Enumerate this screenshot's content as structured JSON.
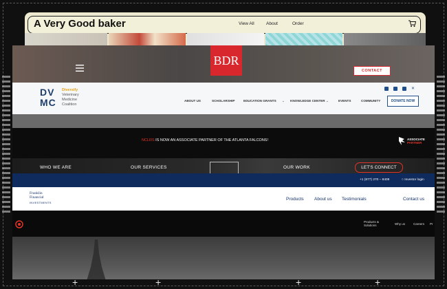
{
  "bakery": {
    "title": "A Very Good baker",
    "nav": [
      "View All",
      "About",
      "Order"
    ],
    "cart_icon": "cart-icon",
    "colors": {
      "background": "#ece9d0",
      "text": "#111111"
    }
  },
  "bdr": {
    "logo": "BDR",
    "contact": "CONTACT",
    "menu_icon": "hamburger-menu-icon",
    "colors": {
      "brand": "#d8282d"
    }
  },
  "dvmc": {
    "logo_top": "DVMC",
    "logo_line1": "DV",
    "logo_line2": "MC",
    "tagline": [
      "Diversify",
      "Veterinary",
      "Medicine",
      "Coalition"
    ],
    "nav": [
      "ABOUT US",
      "SCHOLARSHIP",
      "EDUCATION GRANTS",
      "KNOWLEDGE CENTER",
      "EVENTS",
      "COMMUNITY"
    ],
    "donate": "DONATE NOW",
    "social_icons": [
      "linkedin-icon",
      "facebook-icon",
      "instagram-icon",
      "x-icon"
    ],
    "colors": {
      "primary": "#1e4e8c",
      "accent": "#e8a317"
    }
  },
  "ncsa": {
    "highlight": "NCLRS",
    "text": " IS NOW AN ASSOCIATE PARTNER OF THE ATLANTA FALCONS!",
    "partner_line1": "ASSOCIATE",
    "partner_line2": "PARTNER",
    "colors": {
      "highlight": "#e2342a"
    }
  },
  "navstrip": {
    "items": [
      "WHO WE ARE",
      "OUR SERVICES",
      "OUR WORK"
    ],
    "connect": "LET'S CONNECT"
  },
  "franklin": {
    "phone": "+1 (877) 270 – 8409",
    "login": "Investor login",
    "logo_line1": "Franklin",
    "logo_line2": "Financial",
    "logo_sub": "INVESTMENTS",
    "nav": [
      "Products",
      "About us",
      "Testimonials",
      "Contact us"
    ],
    "colors": {
      "navy": "#0f2a5c"
    }
  },
  "blacknav": {
    "products_line1": "Products &",
    "products_line2": "Solutions",
    "items": [
      "Why us",
      "Careers",
      "Pr"
    ]
  }
}
